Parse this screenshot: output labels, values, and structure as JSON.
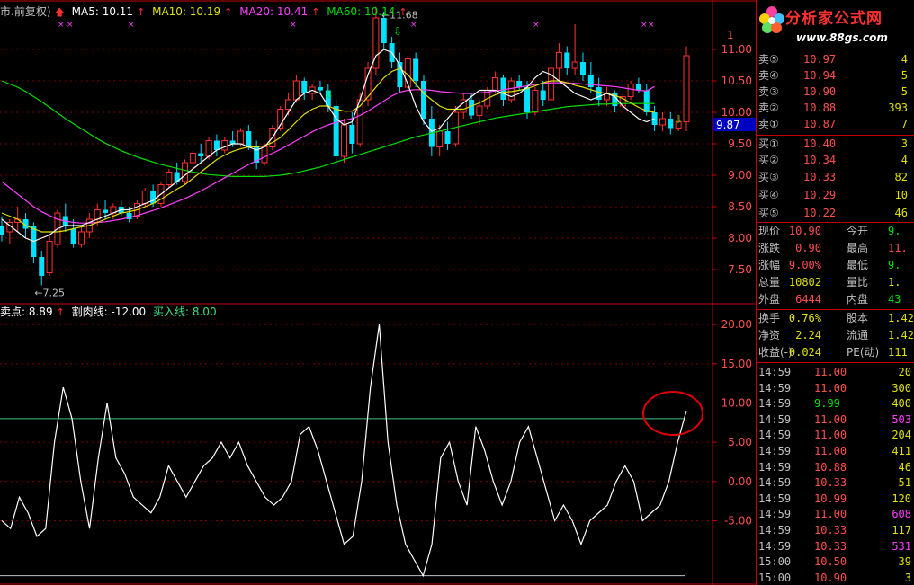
{
  "colors": {
    "up": "#ff3030",
    "down": "#00e0ff",
    "ma5": "#ffffff",
    "ma10": "#e0e000",
    "ma20": "#ff40ff",
    "ma60": "#00e000",
    "grid": "#800000",
    "axis": "#c00000",
    "signal": "#ffffff",
    "buyline": "#40c080"
  },
  "main_legend": {
    "mode": "市.前复权)",
    "ma5_label": "MA5: 10.11",
    "ma10_label": "MA10: 10.19",
    "ma20_label": "MA20: 10.41",
    "ma60_label": "MA60: 10.14"
  },
  "sub_legend": {
    "point_label": "卖点: 8.89",
    "cut_label": "割肉线: -12.00",
    "buy_label": "买入线: 8.00"
  },
  "chart_data": [
    {
      "type": "candlestick",
      "y_ticks": [
        "11.00",
        "10.50",
        "10.00",
        "9.50",
        "9.00",
        "8.50",
        "8.00",
        "7.50"
      ],
      "y_top_partial": "1",
      "ylim": [
        7.0,
        11.5
      ],
      "current_price_tag": "9.87",
      "annotations": {
        "high": "11.68",
        "low": "7.25"
      },
      "candles": [
        {
          "o": 8.2,
          "h": 8.35,
          "l": 7.95,
          "c": 8.05
        },
        {
          "o": 8.1,
          "h": 8.3,
          "l": 7.9,
          "c": 8.25
        },
        {
          "o": 8.25,
          "h": 8.5,
          "l": 8.1,
          "c": 8.3
        },
        {
          "o": 8.3,
          "h": 8.4,
          "l": 8.0,
          "c": 8.15
        },
        {
          "o": 8.2,
          "h": 8.25,
          "l": 7.6,
          "c": 7.7
        },
        {
          "o": 7.7,
          "h": 7.8,
          "l": 7.25,
          "c": 7.4
        },
        {
          "o": 7.45,
          "h": 8.05,
          "l": 7.4,
          "c": 7.95
        },
        {
          "o": 7.9,
          "h": 8.45,
          "l": 7.85,
          "c": 8.4
        },
        {
          "o": 8.35,
          "h": 8.55,
          "l": 8.1,
          "c": 8.2
        },
        {
          "o": 8.15,
          "h": 8.3,
          "l": 7.85,
          "c": 7.9
        },
        {
          "o": 7.9,
          "h": 8.2,
          "l": 7.85,
          "c": 8.1
        },
        {
          "o": 8.1,
          "h": 8.4,
          "l": 8.0,
          "c": 8.3
        },
        {
          "o": 8.3,
          "h": 8.55,
          "l": 8.2,
          "c": 8.45
        },
        {
          "o": 8.45,
          "h": 8.6,
          "l": 8.3,
          "c": 8.4
        },
        {
          "o": 8.4,
          "h": 8.55,
          "l": 8.3,
          "c": 8.5
        },
        {
          "o": 8.5,
          "h": 8.6,
          "l": 8.35,
          "c": 8.4
        },
        {
          "o": 8.4,
          "h": 8.5,
          "l": 8.25,
          "c": 8.3
        },
        {
          "o": 8.35,
          "h": 8.6,
          "l": 8.3,
          "c": 8.55
        },
        {
          "o": 8.55,
          "h": 8.8,
          "l": 8.5,
          "c": 8.75
        },
        {
          "o": 8.75,
          "h": 8.85,
          "l": 8.5,
          "c": 8.55
        },
        {
          "o": 8.55,
          "h": 8.9,
          "l": 8.5,
          "c": 8.85
        },
        {
          "o": 8.85,
          "h": 9.1,
          "l": 8.8,
          "c": 9.05
        },
        {
          "o": 9.05,
          "h": 9.2,
          "l": 8.85,
          "c": 8.9
        },
        {
          "o": 8.9,
          "h": 9.25,
          "l": 8.85,
          "c": 9.2
        },
        {
          "o": 9.2,
          "h": 9.4,
          "l": 9.1,
          "c": 9.35
        },
        {
          "o": 9.35,
          "h": 9.5,
          "l": 9.2,
          "c": 9.3
        },
        {
          "o": 9.3,
          "h": 9.6,
          "l": 9.25,
          "c": 9.55
        },
        {
          "o": 9.55,
          "h": 9.65,
          "l": 9.3,
          "c": 9.4
        },
        {
          "o": 9.4,
          "h": 9.6,
          "l": 9.35,
          "c": 9.55
        },
        {
          "o": 9.55,
          "h": 9.7,
          "l": 9.45,
          "c": 9.5
        },
        {
          "o": 9.5,
          "h": 9.75,
          "l": 9.45,
          "c": 9.7
        },
        {
          "o": 9.7,
          "h": 9.8,
          "l": 9.4,
          "c": 9.45
        },
        {
          "o": 9.45,
          "h": 9.55,
          "l": 9.1,
          "c": 9.2
        },
        {
          "o": 9.2,
          "h": 9.5,
          "l": 9.15,
          "c": 9.45
        },
        {
          "o": 9.45,
          "h": 9.8,
          "l": 9.4,
          "c": 9.75
        },
        {
          "o": 9.75,
          "h": 10.1,
          "l": 9.7,
          "c": 10.05
        },
        {
          "o": 10.05,
          "h": 10.3,
          "l": 9.95,
          "c": 10.2
        },
        {
          "o": 10.2,
          "h": 10.6,
          "l": 10.15,
          "c": 10.5
        },
        {
          "o": 10.5,
          "h": 10.55,
          "l": 10.2,
          "c": 10.3
        },
        {
          "o": 10.3,
          "h": 10.45,
          "l": 10.2,
          "c": 10.4
        },
        {
          "o": 10.4,
          "h": 10.5,
          "l": 10.3,
          "c": 10.35
        },
        {
          "o": 10.35,
          "h": 10.45,
          "l": 10.0,
          "c": 10.1
        },
        {
          "o": 10.1,
          "h": 10.2,
          "l": 9.2,
          "c": 9.3
        },
        {
          "o": 9.3,
          "h": 9.9,
          "l": 9.2,
          "c": 9.8
        },
        {
          "o": 9.8,
          "h": 10.0,
          "l": 9.35,
          "c": 9.5
        },
        {
          "o": 9.5,
          "h": 10.3,
          "l": 9.45,
          "c": 10.2
        },
        {
          "o": 10.2,
          "h": 10.8,
          "l": 10.1,
          "c": 10.7
        },
        {
          "o": 10.7,
          "h": 11.68,
          "l": 10.6,
          "c": 11.5
        },
        {
          "o": 11.5,
          "h": 11.6,
          "l": 11.0,
          "c": 11.1
        },
        {
          "o": 11.1,
          "h": 11.2,
          "l": 10.7,
          "c": 10.8
        },
        {
          "o": 10.8,
          "h": 10.95,
          "l": 10.3,
          "c": 10.4
        },
        {
          "o": 10.4,
          "h": 10.9,
          "l": 10.35,
          "c": 10.85
        },
        {
          "o": 10.85,
          "h": 10.95,
          "l": 10.4,
          "c": 10.5
        },
        {
          "o": 10.5,
          "h": 10.6,
          "l": 9.8,
          "c": 9.9
        },
        {
          "o": 9.9,
          "h": 10.1,
          "l": 9.3,
          "c": 9.45
        },
        {
          "o": 9.45,
          "h": 9.8,
          "l": 9.3,
          "c": 9.7
        },
        {
          "o": 9.7,
          "h": 9.85,
          "l": 9.4,
          "c": 9.5
        },
        {
          "o": 9.5,
          "h": 10.1,
          "l": 9.45,
          "c": 10.0
        },
        {
          "o": 10.0,
          "h": 10.3,
          "l": 9.9,
          "c": 10.2
        },
        {
          "o": 10.2,
          "h": 10.3,
          "l": 9.9,
          "c": 9.95
        },
        {
          "o": 9.95,
          "h": 10.2,
          "l": 9.8,
          "c": 10.1
        },
        {
          "o": 10.1,
          "h": 10.4,
          "l": 10.05,
          "c": 10.35
        },
        {
          "o": 10.35,
          "h": 10.65,
          "l": 10.3,
          "c": 10.55
        },
        {
          "o": 10.55,
          "h": 10.6,
          "l": 10.1,
          "c": 10.2
        },
        {
          "o": 10.2,
          "h": 10.55,
          "l": 10.15,
          "c": 10.5
        },
        {
          "o": 10.5,
          "h": 10.6,
          "l": 10.35,
          "c": 10.4
        },
        {
          "o": 10.4,
          "h": 10.5,
          "l": 9.9,
          "c": 10.0
        },
        {
          "o": 10.0,
          "h": 10.4,
          "l": 9.95,
          "c": 10.35
        },
        {
          "o": 10.35,
          "h": 10.5,
          "l": 10.1,
          "c": 10.2
        },
        {
          "o": 10.2,
          "h": 10.8,
          "l": 10.15,
          "c": 10.7
        },
        {
          "o": 10.7,
          "h": 11.1,
          "l": 10.5,
          "c": 10.95
        },
        {
          "o": 10.95,
          "h": 11.05,
          "l": 10.6,
          "c": 10.7
        },
        {
          "o": 10.7,
          "h": 11.4,
          "l": 10.6,
          "c": 10.8
        },
        {
          "o": 10.8,
          "h": 10.95,
          "l": 10.5,
          "c": 10.6
        },
        {
          "o": 10.6,
          "h": 10.8,
          "l": 10.3,
          "c": 10.4
        },
        {
          "o": 10.4,
          "h": 10.55,
          "l": 10.1,
          "c": 10.2
        },
        {
          "o": 10.2,
          "h": 10.4,
          "l": 10.1,
          "c": 10.3
        },
        {
          "o": 10.3,
          "h": 10.35,
          "l": 10.0,
          "c": 10.1
        },
        {
          "o": 10.1,
          "h": 10.3,
          "l": 10.05,
          "c": 10.25
        },
        {
          "o": 10.25,
          "h": 10.5,
          "l": 10.2,
          "c": 10.45
        },
        {
          "o": 10.45,
          "h": 10.55,
          "l": 10.3,
          "c": 10.35
        },
        {
          "o": 10.35,
          "h": 10.45,
          "l": 9.95,
          "c": 10.0
        },
        {
          "o": 10.0,
          "h": 10.1,
          "l": 9.7,
          "c": 9.8
        },
        {
          "o": 9.8,
          "h": 10.0,
          "l": 9.7,
          "c": 9.9
        },
        {
          "o": 9.9,
          "h": 10.0,
          "l": 9.65,
          "c": 9.75
        },
        {
          "o": 9.75,
          "h": 9.95,
          "l": 9.7,
          "c": 9.85
        },
        {
          "o": 9.85,
          "h": 11.05,
          "l": 9.7,
          "c": 10.9
        }
      ],
      "ma5": [
        8.3,
        8.2,
        8.1,
        8.0,
        7.95,
        8.0,
        8.05,
        8.15,
        8.2,
        8.2,
        8.2,
        8.25,
        8.3,
        8.35,
        8.4,
        8.45,
        8.45,
        8.5,
        8.55,
        8.6,
        8.7,
        8.8,
        8.9,
        9.0,
        9.1,
        9.2,
        9.3,
        9.4,
        9.45,
        9.5,
        9.5,
        9.45,
        9.4,
        9.45,
        9.6,
        9.8,
        10.0,
        10.2,
        10.3,
        10.35,
        10.3,
        10.1,
        9.9,
        9.8,
        9.85,
        10.2,
        10.6,
        10.9,
        11.0,
        10.95,
        10.75,
        10.45,
        10.1,
        9.85,
        9.7,
        9.75,
        9.9,
        10.05,
        10.15,
        10.25,
        10.35,
        10.35,
        10.35,
        10.3,
        10.25,
        10.3,
        10.4,
        10.55,
        10.65,
        10.6,
        10.5,
        10.4,
        10.3,
        10.25,
        10.2,
        10.25,
        10.3,
        10.25,
        10.1,
        10.0,
        9.9,
        9.85,
        9.9
      ],
      "ma10": [
        8.4,
        8.35,
        8.3,
        8.2,
        8.15,
        8.1,
        8.1,
        8.1,
        8.12,
        8.15,
        8.18,
        8.2,
        8.25,
        8.3,
        8.35,
        8.4,
        8.42,
        8.45,
        8.5,
        8.55,
        8.62,
        8.7,
        8.78,
        8.85,
        8.95,
        9.05,
        9.15,
        9.25,
        9.32,
        9.38,
        9.42,
        9.45,
        9.45,
        9.47,
        9.52,
        9.6,
        9.72,
        9.85,
        9.97,
        10.05,
        10.1,
        10.1,
        10.05,
        10.02,
        10.02,
        10.1,
        10.25,
        10.4,
        10.55,
        10.65,
        10.7,
        10.6,
        10.45,
        10.3,
        10.2,
        10.1,
        10.05,
        10.05,
        10.05,
        10.1,
        10.15,
        10.22,
        10.28,
        10.32,
        10.33,
        10.35,
        10.38,
        10.42,
        10.47,
        10.5,
        10.5,
        10.47,
        10.43,
        10.4,
        10.36,
        10.32,
        10.3,
        10.27,
        10.22,
        10.15,
        10.08,
        10.02,
        10.0
      ],
      "ma20": [
        8.9,
        8.8,
        8.7,
        8.6,
        8.5,
        8.42,
        8.36,
        8.3,
        8.27,
        8.25,
        8.24,
        8.24,
        8.25,
        8.26,
        8.28,
        8.3,
        8.33,
        8.36,
        8.4,
        8.44,
        8.48,
        8.53,
        8.58,
        8.63,
        8.69,
        8.75,
        8.82,
        8.89,
        8.96,
        9.03,
        9.1,
        9.17,
        9.23,
        9.29,
        9.35,
        9.41,
        9.48,
        9.55,
        9.62,
        9.69,
        9.75,
        9.8,
        9.84,
        9.87,
        9.9,
        9.95,
        10.02,
        10.1,
        10.18,
        10.26,
        10.32,
        10.35,
        10.36,
        10.36,
        10.35,
        10.33,
        10.32,
        10.31,
        10.3,
        10.3,
        10.31,
        10.32,
        10.34,
        10.36,
        10.38,
        10.4,
        10.42,
        10.44,
        10.46,
        10.47,
        10.47,
        10.47,
        10.46,
        10.45,
        10.44,
        10.43,
        10.42,
        10.41,
        10.39,
        10.37,
        10.35,
        10.34,
        10.41
      ],
      "ma60": [
        10.5,
        10.45,
        10.4,
        10.33,
        10.25,
        10.17,
        10.08,
        9.99,
        9.9,
        9.82,
        9.74,
        9.66,
        9.58,
        9.51,
        9.45,
        9.39,
        9.34,
        9.29,
        9.25,
        9.21,
        9.17,
        9.14,
        9.11,
        9.08,
        9.05,
        9.03,
        9.01,
        9.0,
        8.99,
        8.98,
        8.98,
        8.98,
        8.98,
        8.98,
        8.99,
        9.0,
        9.02,
        9.04,
        9.07,
        9.1,
        9.13,
        9.17,
        9.21,
        9.25,
        9.29,
        9.33,
        9.37,
        9.41,
        9.45,
        9.49,
        9.53,
        9.57,
        9.61,
        9.64,
        9.67,
        9.7,
        9.73,
        9.76,
        9.79,
        9.82,
        9.85,
        9.88,
        9.91,
        9.93,
        9.95,
        9.97,
        9.99,
        10.01,
        10.03,
        10.05,
        10.07,
        10.09,
        10.1,
        10.11,
        10.12,
        10.13,
        10.13,
        10.14,
        10.14,
        10.14,
        10.14,
        10.14,
        10.14
      ]
    },
    {
      "type": "line",
      "y_ticks": [
        "20.00",
        "15.00",
        "10.00",
        "5.00",
        "0.00",
        "-5.00"
      ],
      "ylim": [
        -12.5,
        21.5
      ],
      "buy_line": 8.0,
      "cut_line": -12.0,
      "values": [
        -5,
        -6,
        -2,
        -4,
        -7,
        -6,
        5,
        12,
        8,
        0,
        -6,
        3,
        10,
        3,
        1,
        -2,
        -3,
        -4,
        -2,
        2,
        0,
        -2,
        0,
        2,
        3,
        5,
        3,
        5,
        2,
        0,
        -2,
        -3,
        -2,
        0,
        6,
        7,
        4,
        0,
        -4,
        -8,
        -7,
        0,
        12,
        20,
        5,
        -3,
        -8,
        -10,
        -12,
        -8,
        3,
        5,
        0,
        -3,
        7,
        4,
        0,
        -3,
        0,
        5,
        7,
        3,
        -1,
        -5,
        -3,
        -5,
        -8,
        -5,
        -4,
        -3,
        0,
        2,
        0,
        -5,
        -4,
        -3,
        0,
        5,
        9
      ]
    }
  ],
  "panel": {
    "logo_title": "分析家公式网",
    "logo_url": "www.88gs.com",
    "asks": [
      {
        "label": "卖⑤",
        "price": "10.97",
        "vol": "4"
      },
      {
        "label": "卖④",
        "price": "10.94",
        "vol": "5"
      },
      {
        "label": "卖③",
        "price": "10.90",
        "vol": "5"
      },
      {
        "label": "卖②",
        "price": "10.88",
        "vol": "393"
      },
      {
        "label": "卖①",
        "price": "10.87",
        "vol": "7"
      }
    ],
    "bids": [
      {
        "label": "买①",
        "price": "10.40",
        "vol": "3"
      },
      {
        "label": "买②",
        "price": "10.34",
        "vol": "4"
      },
      {
        "label": "买③",
        "price": "10.33",
        "vol": "82"
      },
      {
        "label": "买④",
        "price": "10.29",
        "vol": "10"
      },
      {
        "label": "买⑤",
        "price": "10.22",
        "vol": "46"
      }
    ],
    "quote": [
      {
        "k1": "现价",
        "v1": "10.90",
        "c1": "red",
        "k2": "今开",
        "v2": "9.",
        "c2": "green"
      },
      {
        "k1": "涨跌",
        "v1": "0.90",
        "c1": "red",
        "k2": "最高",
        "v2": "11.",
        "c2": "red"
      },
      {
        "k1": "涨幅",
        "v1": "9.00%",
        "c1": "red",
        "k2": "最低",
        "v2": "9.",
        "c2": "green"
      },
      {
        "k1": "总量",
        "v1": "10802",
        "c1": "yellow",
        "k2": "量比",
        "v2": "1.",
        "c2": "yellow"
      },
      {
        "k1": "外盘",
        "v1": "6444",
        "c1": "red",
        "k2": "内盘",
        "v2": "43",
        "c2": "green"
      }
    ],
    "info": [
      {
        "k1": "换手",
        "v1": "0.76%",
        "c1": "yellow",
        "k2": "股本",
        "v2": "1.42",
        "c2": "yellow"
      },
      {
        "k1": "净资",
        "v1": "2.24",
        "c1": "yellow",
        "k2": "流通",
        "v2": "1.42",
        "c2": "yellow"
      },
      {
        "k1": "收益(-)",
        "v1": "0.024",
        "c1": "yellow",
        "k2": "PE(动)",
        "v2": "111",
        "c2": "yellow"
      }
    ],
    "ticks": [
      {
        "t": "14:59",
        "p": "11.00",
        "pc": "red",
        "v": "20",
        "vc": "yellow"
      },
      {
        "t": "14:59",
        "p": "11.00",
        "pc": "red",
        "v": "300",
        "vc": "yellow"
      },
      {
        "t": "14:59",
        "p": "9.99",
        "pc": "green",
        "v": "400",
        "vc": "yellow"
      },
      {
        "t": "14:59",
        "p": "11.00",
        "pc": "red",
        "v": "503",
        "vc": "mag"
      },
      {
        "t": "14:59",
        "p": "11.00",
        "pc": "red",
        "v": "204",
        "vc": "yellow"
      },
      {
        "t": "14:59",
        "p": "11.00",
        "pc": "red",
        "v": "411",
        "vc": "yellow"
      },
      {
        "t": "14:59",
        "p": "10.88",
        "pc": "red",
        "v": "46",
        "vc": "yellow"
      },
      {
        "t": "14:59",
        "p": "10.33",
        "pc": "red",
        "v": "51",
        "vc": "yellow"
      },
      {
        "t": "14:59",
        "p": "10.99",
        "pc": "red",
        "v": "120",
        "vc": "yellow"
      },
      {
        "t": "14:59",
        "p": "11.00",
        "pc": "red",
        "v": "608",
        "vc": "mag"
      },
      {
        "t": "14:59",
        "p": "10.33",
        "pc": "red",
        "v": "117",
        "vc": "yellow"
      },
      {
        "t": "14:59",
        "p": "10.33",
        "pc": "red",
        "v": "531",
        "vc": "mag"
      },
      {
        "t": "15:00",
        "p": "10.50",
        "pc": "red",
        "v": "39",
        "vc": "yellow"
      },
      {
        "t": "15:00",
        "p": "10.90",
        "pc": "red",
        "v": "3",
        "vc": "yellow"
      }
    ]
  }
}
